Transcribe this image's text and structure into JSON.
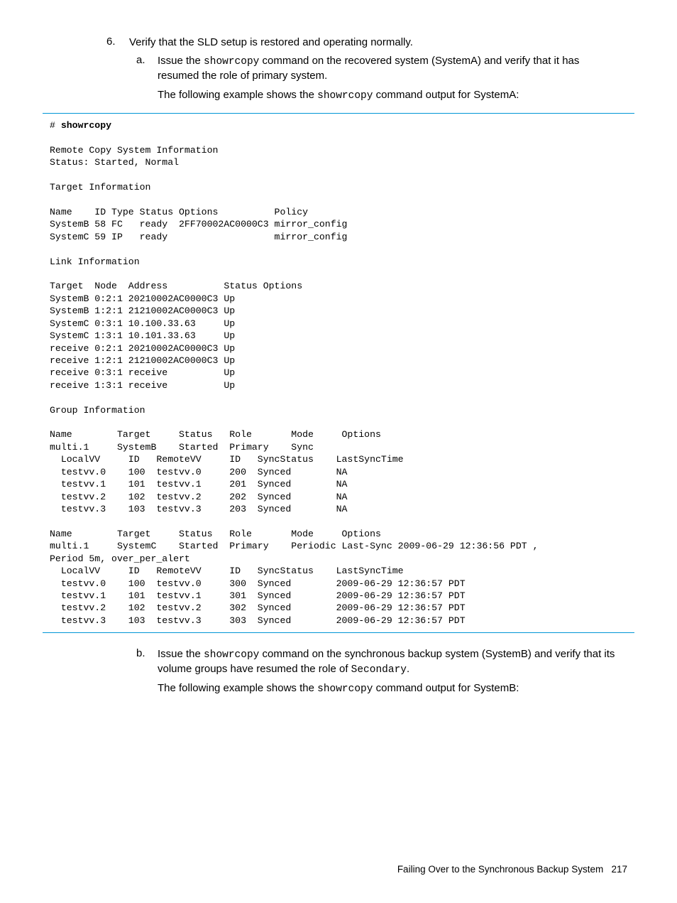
{
  "step6": {
    "num": "6.",
    "text": "Verify that the SLD setup is restored and operating normally.",
    "a": {
      "num": "a.",
      "line1_pre": "Issue the ",
      "cmd": "showrcopy",
      "line1_post": " command on the recovered system (SystemA) and verify that it has resumed the role of primary system.",
      "line2_pre": "The following example shows the ",
      "cmd2": "showrcopy",
      "line2_post": " command output for SystemA:"
    },
    "b": {
      "num": "b.",
      "line1_pre": "Issue the ",
      "cmd": "showrcopy",
      "line1_post": " command on the synchronous backup system (SystemB) and verify that its volume groups have resumed the role of ",
      "role": "Secondary",
      "line1_end": ".",
      "line2_pre": "The following example shows the ",
      "cmd2": "showrcopy",
      "line2_post": " command output for SystemB:"
    }
  },
  "code": {
    "prompt_cmd": "# ",
    "cmd_bold": "showrcopy",
    "body": "\n\nRemote Copy System Information\nStatus: Started, Normal\n\nTarget Information\n\nName    ID Type Status Options          Policy\nSystemB 58 FC   ready  2FF70002AC0000C3 mirror_config\nSystemC 59 IP   ready                   mirror_config\n\nLink Information\n\nTarget  Node  Address          Status Options\nSystemB 0:2:1 20210002AC0000C3 Up\nSystemB 1:2:1 21210002AC0000C3 Up\nSystemC 0:3:1 10.100.33.63     Up\nSystemC 1:3:1 10.101.33.63     Up\nreceive 0:2:1 20210002AC0000C3 Up\nreceive 1:2:1 21210002AC0000C3 Up\nreceive 0:3:1 receive          Up\nreceive 1:3:1 receive          Up\n\nGroup Information\n\nName        Target     Status   Role       Mode     Options\nmulti.1     SystemB    Started  Primary    Sync\n  LocalVV     ID   RemoteVV     ID   SyncStatus    LastSyncTime\n  testvv.0    100  testvv.0     200  Synced        NA\n  testvv.1    101  testvv.1     201  Synced        NA\n  testvv.2    102  testvv.2     202  Synced        NA\n  testvv.3    103  testvv.3     203  Synced        NA\n\nName        Target     Status   Role       Mode     Options\nmulti.1     SystemC    Started  Primary    Periodic Last-Sync 2009-06-29 12:36:56 PDT ,\nPeriod 5m, over_per_alert\n  LocalVV     ID   RemoteVV     ID   SyncStatus    LastSyncTime\n  testvv.0    100  testvv.0     300  Synced        2009-06-29 12:36:57 PDT\n  testvv.1    101  testvv.1     301  Synced        2009-06-29 12:36:57 PDT\n  testvv.2    102  testvv.2     302  Synced        2009-06-29 12:36:57 PDT\n  testvv.3    103  testvv.3     303  Synced        2009-06-29 12:36:57 PDT"
  },
  "footer": {
    "text": "Failing Over to the Synchronous Backup System",
    "page": "217"
  }
}
